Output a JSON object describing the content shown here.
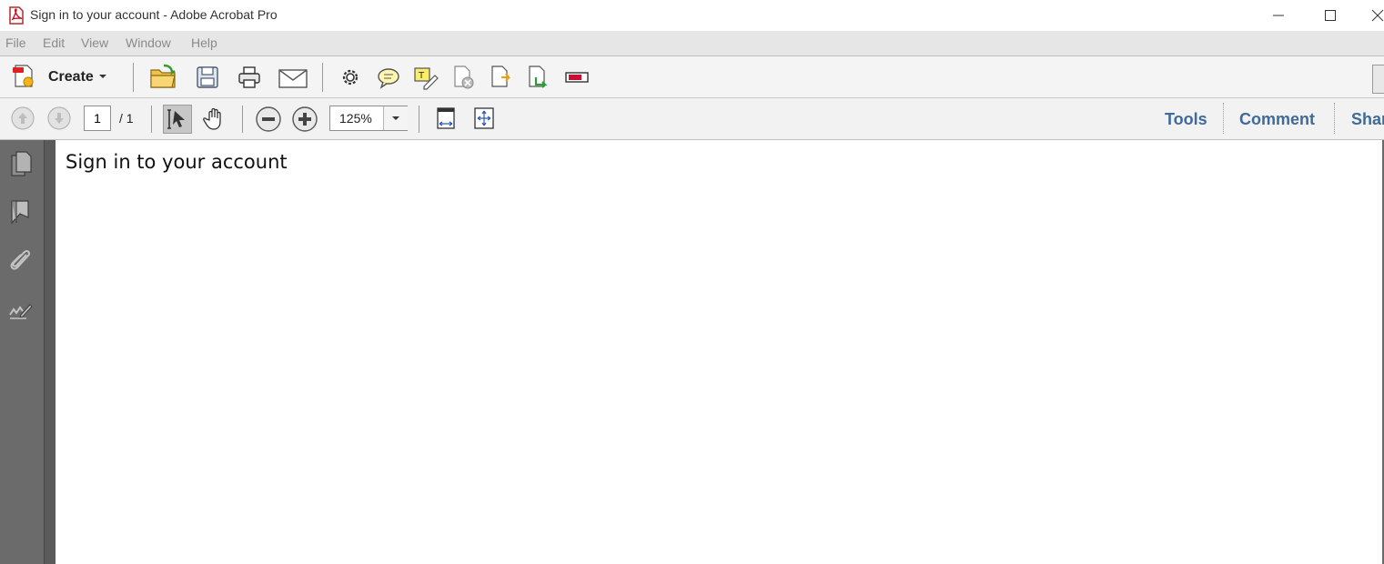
{
  "window": {
    "title": "Sign in to your account - Adobe Acrobat Pro"
  },
  "menu": [
    "File",
    "Edit",
    "View",
    "Window",
    "Help"
  ],
  "toolbar": {
    "create_label": "Create"
  },
  "navigation": {
    "current_page": "1",
    "page_total": "/ 1",
    "zoom": "125%"
  },
  "panels": {
    "tools": "Tools",
    "comment": "Comment",
    "share": "Shar"
  },
  "document": {
    "text": "Sign in to your account"
  },
  "colors": {
    "panel_link": "#3f6a99",
    "nav_pane": "#6b6b6b",
    "menu_bg": "#e6e6e6"
  }
}
